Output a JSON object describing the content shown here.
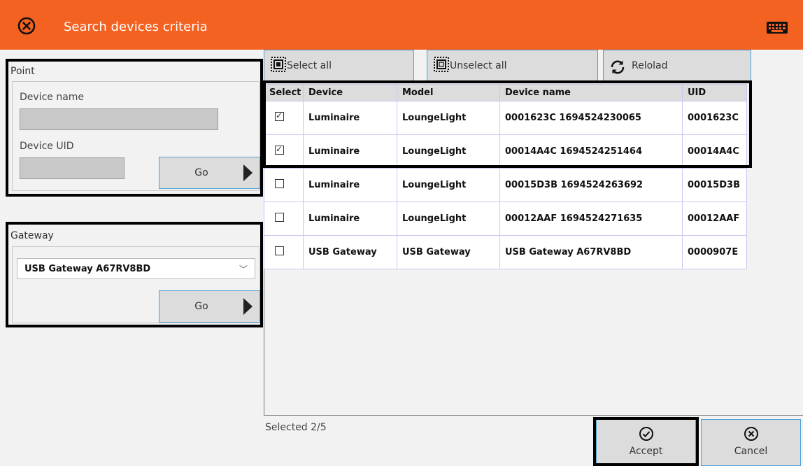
{
  "titlebar": {
    "title": "Search devices criteria",
    "close_icon": "close-circle-icon",
    "keyboard_icon": "keyboard-icon",
    "color": "#f46222"
  },
  "point_panel": {
    "title": "Point",
    "device_name_label": "Device name",
    "device_name_value": "",
    "device_uid_label": "Device UID",
    "device_uid_value": "",
    "go_label": "Go"
  },
  "gateway_panel": {
    "title": "Gateway",
    "selected": "USB Gateway A67RV8BD",
    "go_label": "Go"
  },
  "toolbar": {
    "select_all": "Select all",
    "unselect_all": "Unselect all",
    "reload": "Relolad"
  },
  "grid": {
    "columns": [
      "Select",
      "Device",
      "Model",
      "Device name",
      "UID"
    ],
    "rows": [
      {
        "selected": true,
        "device": "Luminaire",
        "model": "LoungeLight",
        "device_name": "0001623C 1694524230065",
        "uid": "0001623C"
      },
      {
        "selected": true,
        "device": "Luminaire",
        "model": "LoungeLight",
        "device_name": "00014A4C 1694524251464",
        "uid": "00014A4C"
      },
      {
        "selected": false,
        "device": "Luminaire",
        "model": "LoungeLight",
        "device_name": "00015D3B 1694524263692",
        "uid": "00015D3B"
      },
      {
        "selected": false,
        "device": "Luminaire",
        "model": "LoungeLight",
        "device_name": "00012AAF 1694524271635",
        "uid": "00012AAF"
      },
      {
        "selected": false,
        "device": "USB Gateway",
        "model": "USB Gateway",
        "device_name": "USB Gateway A67RV8BD",
        "uid": "0000907E"
      }
    ]
  },
  "status": {
    "text": "Selected 2/5"
  },
  "actions": {
    "accept": "Accept",
    "cancel": "Cancel"
  }
}
